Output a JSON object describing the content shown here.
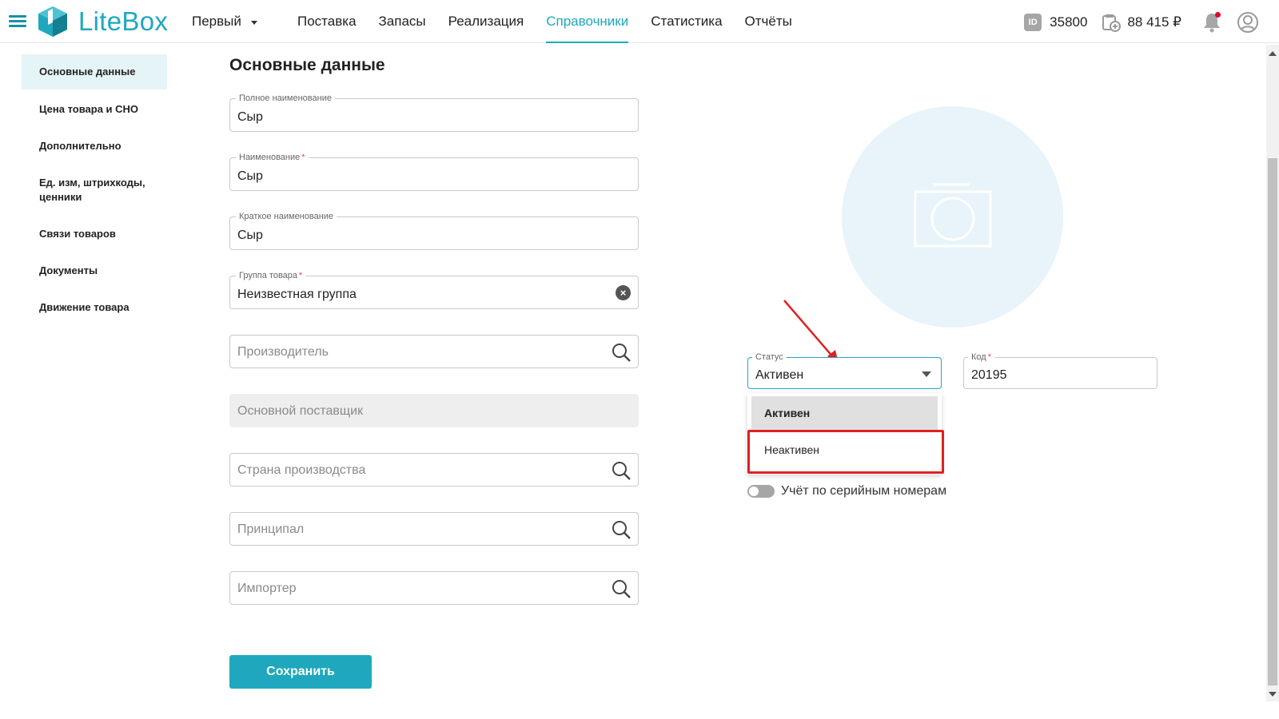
{
  "header": {
    "logo_text": "LiteBox",
    "company": "Первый",
    "nav": [
      {
        "label": "Поставка",
        "active": false
      },
      {
        "label": "Запасы",
        "active": false
      },
      {
        "label": "Реализация",
        "active": false
      },
      {
        "label": "Справочники",
        "active": true
      },
      {
        "label": "Статистика",
        "active": false
      },
      {
        "label": "Отчёты",
        "active": false
      }
    ],
    "id_badge": "ID",
    "id_value": "35800",
    "balance": "88 415 ₽"
  },
  "sidebar": {
    "items": [
      {
        "label": "Основные данные",
        "active": true
      },
      {
        "label": "Цена товара и СНО"
      },
      {
        "label": "Дополнительно"
      },
      {
        "label": "Ед. изм, штрихкоды, ценники"
      },
      {
        "label": "Связи товаров"
      },
      {
        "label": "Документы"
      },
      {
        "label": "Движение товара"
      }
    ]
  },
  "main": {
    "title": "Основные данные",
    "fields": {
      "full_name": {
        "label": "Полное наименование",
        "value": "Сыр"
      },
      "name": {
        "label": "Наименование",
        "required": "*",
        "value": "Сыр"
      },
      "short_name": {
        "label": "Краткое наименование",
        "value": "Сыр"
      },
      "group": {
        "label": "Группа товара",
        "required": "*",
        "value": "Неизвестная группа"
      },
      "manufacturer": {
        "placeholder": "Производитель"
      },
      "main_supplier": {
        "placeholder": "Основной поставщик"
      },
      "country": {
        "placeholder": "Страна производства"
      },
      "principal": {
        "placeholder": "Принципал"
      },
      "importer": {
        "placeholder": "Импортер"
      }
    },
    "save_label": "Сохранить"
  },
  "right": {
    "status": {
      "label": "Статус",
      "value": "Активен",
      "options": [
        "Активен",
        "Неактивен"
      ]
    },
    "code": {
      "label": "Код",
      "required": "*",
      "value": "20195"
    },
    "serial_toggle": {
      "label": "Учёт по серийным номерам",
      "on": false
    }
  },
  "colors": {
    "accent": "#1fa8bd",
    "highlight": "#e02020",
    "photo_bg": "#e8f4f9"
  }
}
